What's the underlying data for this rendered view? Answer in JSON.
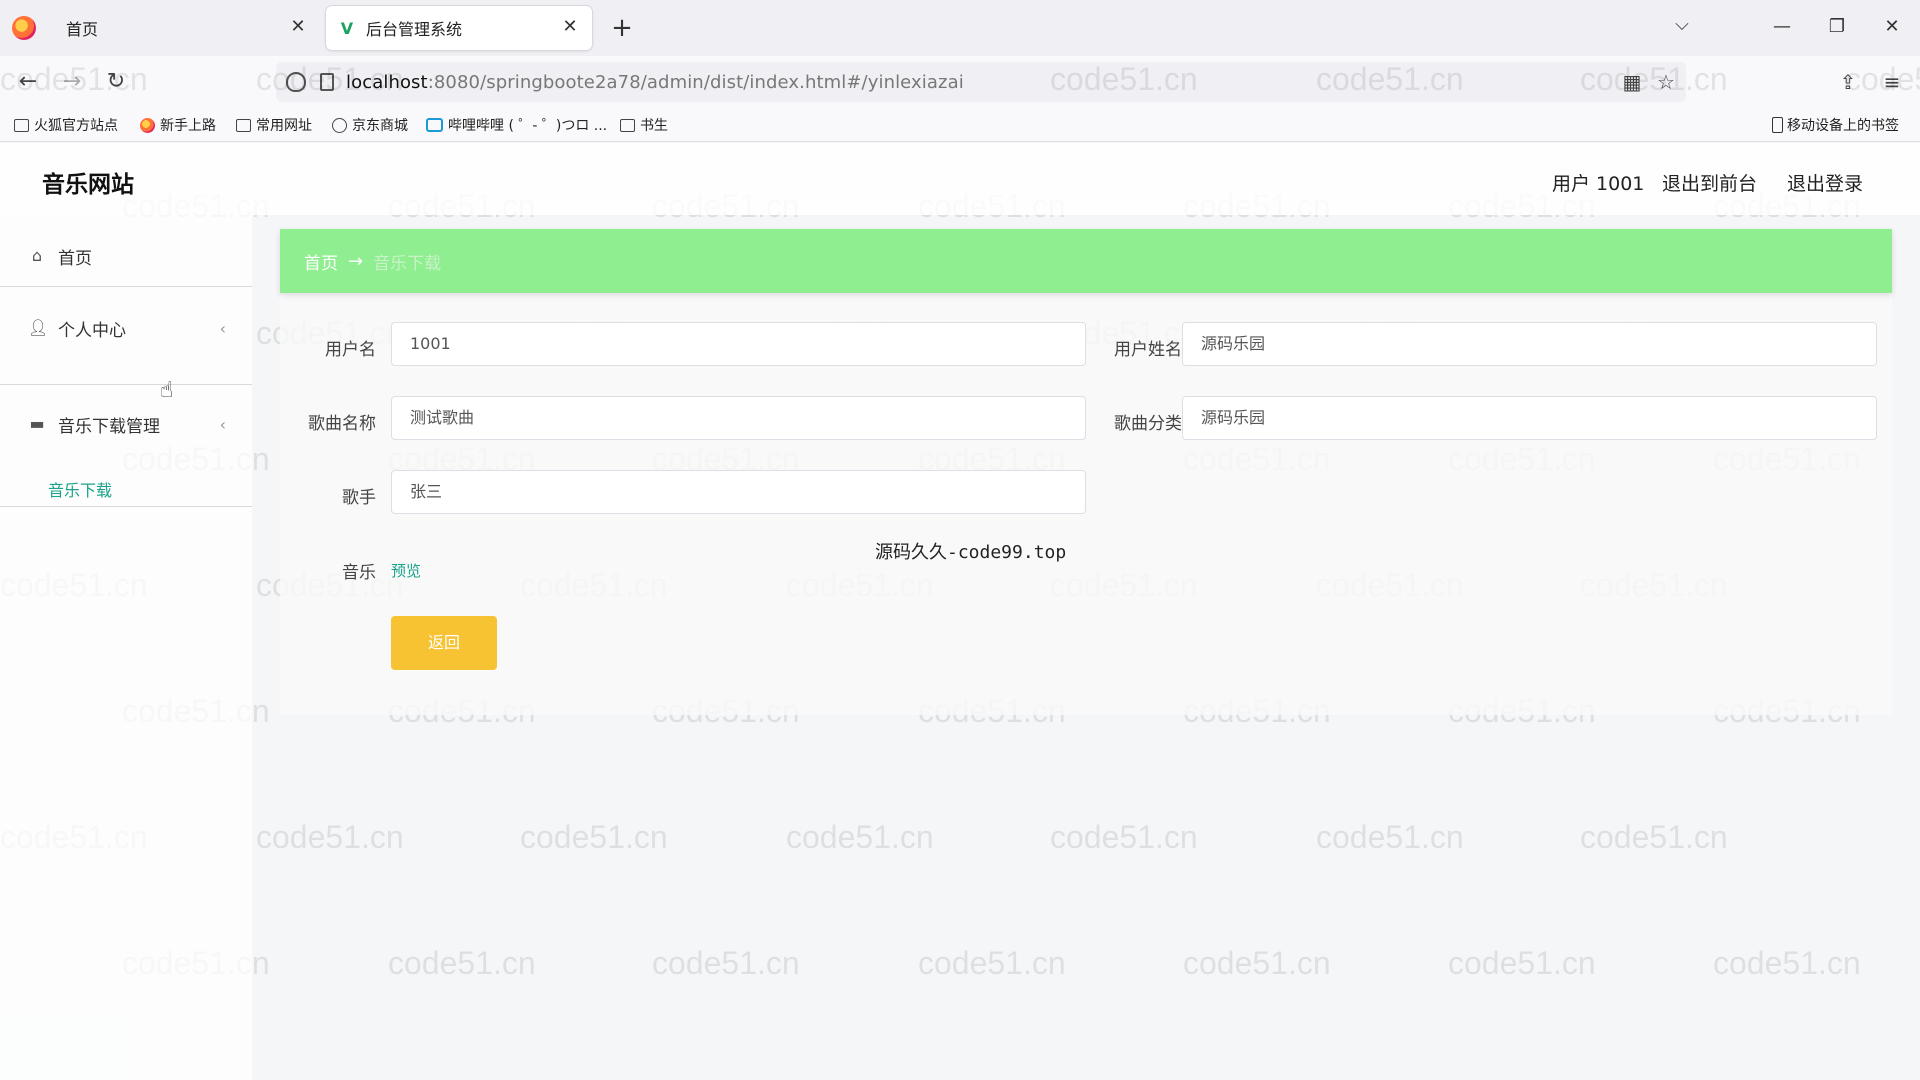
{
  "browser": {
    "tabs": [
      {
        "label": "首页",
        "active": false
      },
      {
        "label": "后台管理系统",
        "active": true
      }
    ],
    "url_host": "localhost",
    "url_rest": ":8080/springboote2a78/admin/dist/index.html#/yinlexiazai",
    "bookmarks": [
      "火狐官方站点",
      "新手上路",
      "常用网址",
      "京东商城",
      "哔哩哔哩 ( ゜- ゜)つロ ...",
      "书生"
    ],
    "mobile_bookmarks": "移动设备上的书签"
  },
  "app": {
    "site_title": "音乐网站",
    "header_links": {
      "user": "用户 1001",
      "to_front": "退出到前台",
      "logout": "退出登录"
    },
    "sidebar": {
      "home": "首页",
      "personal_center": "个人中心",
      "music_download_mgmt": "音乐下载管理",
      "music_download": "音乐下载"
    },
    "breadcrumb": {
      "home": "首页",
      "arrow": "→",
      "current": "音乐下载"
    },
    "form": {
      "username_label": "用户名",
      "username_value": "1001",
      "realname_label": "用户姓名",
      "realname_value": "源码乐园",
      "song_label": "歌曲名称",
      "song_value": "测试歌曲",
      "category_label": "歌曲分类",
      "category_value": "源码乐园",
      "singer_label": "歌手",
      "singer_value": "张三",
      "music_label": "音乐",
      "preview_link": "预览",
      "back_button": "返回"
    },
    "overlay_text": "源码久久-code99.top"
  },
  "watermark_text": "code51.cn",
  "colors": {
    "breadcrumb_bg": "#8fee8f",
    "accent": "#1aa38a",
    "button": "#f7c332"
  }
}
